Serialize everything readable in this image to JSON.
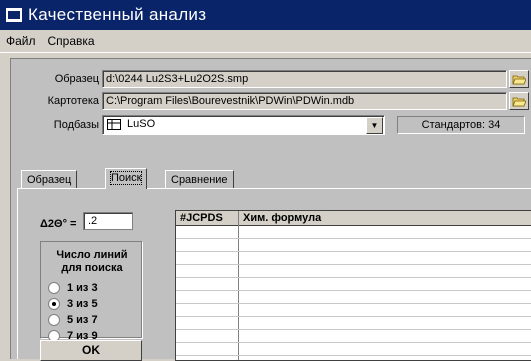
{
  "window": {
    "title": "Качественный анализ"
  },
  "menu": [
    "Файл",
    "Справка"
  ],
  "fields": {
    "sample_label": "Образец",
    "sample_value": "d:\\0244 Lu2S3+Lu2O2S.smp",
    "cardfile_label": "Картотека",
    "cardfile_value": "C:\\Program Files\\Bourevestnik\\PDWin\\PDWin.mdb",
    "subbase_label": "Подбазы",
    "subbase_value": "LuSO",
    "standards": "Стандартов: 34"
  },
  "tabs": [
    "Образец",
    "Поиск",
    "Сравнение"
  ],
  "search": {
    "delta_label": "Δ2Θ° =",
    "delta_value": ".2",
    "group_title_1": "Число линий",
    "group_title_2": "для поиска",
    "options": [
      "1 из 3",
      "3 из 5",
      "5 из 7",
      "7 из 9"
    ],
    "selected_index": 1,
    "ok_label": "OK"
  },
  "grid": {
    "columns": [
      "#JCPDS",
      "Хим. формула"
    ]
  },
  "icons": [
    "app-window-icon",
    "folder-open-icon",
    "folder-open-icon",
    "database-icon",
    "chevron-down-icon"
  ]
}
